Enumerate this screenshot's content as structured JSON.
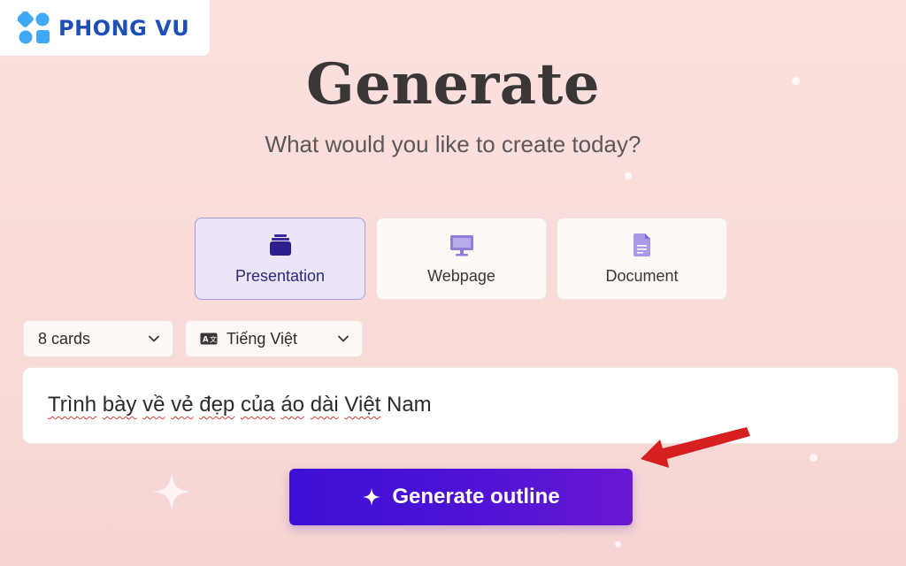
{
  "logo": {
    "text": "PHONG VU"
  },
  "header": {
    "title": "Generate",
    "subtitle": "What would you like to create today?"
  },
  "content_types": [
    {
      "label": "Presentation",
      "icon": "presentation-icon",
      "selected": true
    },
    {
      "label": "Webpage",
      "icon": "monitor-icon",
      "selected": false
    },
    {
      "label": "Document",
      "icon": "document-icon",
      "selected": false
    }
  ],
  "options": {
    "cards": {
      "value": "8 cards"
    },
    "language": {
      "value": "Tiếng Việt",
      "icon": "language-icon"
    }
  },
  "prompt": {
    "words": [
      "Trình",
      "bày",
      "về",
      "vẻ",
      "đẹp",
      "của",
      "áo",
      "dài",
      "Việt",
      "Nam"
    ]
  },
  "generate_button": {
    "label": "Generate outline",
    "icon": "sparkle-icon"
  },
  "colors": {
    "accent": "#4a12d6",
    "selected_card_bg": "#ebe5f7",
    "arrow": "#d61f1f",
    "logo": "#1e4fb8"
  }
}
